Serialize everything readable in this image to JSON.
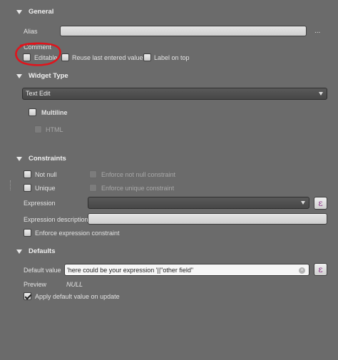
{
  "general": {
    "title": "General",
    "alias_label": "Alias",
    "alias_value": "",
    "more_button": "...",
    "comment_label": "Comment",
    "editable_label": "Editable",
    "reuse_label": "Reuse last entered value",
    "label_on_top": "Label on top"
  },
  "widget_type": {
    "title": "Widget Type",
    "selected": "Text Edit",
    "multiline_label": "Multiline",
    "html_label": "HTML"
  },
  "constraints": {
    "title": "Constraints",
    "not_null_label": "Not null",
    "enforce_not_null_label": "Enforce not null constraint",
    "unique_label": "Unique",
    "enforce_unique_label": "Enforce unique constraint",
    "expression_label": "Expression",
    "expression_value": "",
    "expression_description_label": "Expression description",
    "expression_description_value": "",
    "enforce_expression_label": "Enforce expression constraint",
    "expression_button": "ε"
  },
  "defaults": {
    "title": "Defaults",
    "default_value_label": "Default value",
    "default_value": "'here could be your expression '||\"other field\"",
    "preview_label": "Preview",
    "preview_value": "NULL",
    "apply_on_update_label": "Apply default value on update",
    "expression_button": "ε",
    "clear_icon": "×"
  },
  "annotation": {
    "color": "#e0141c"
  }
}
